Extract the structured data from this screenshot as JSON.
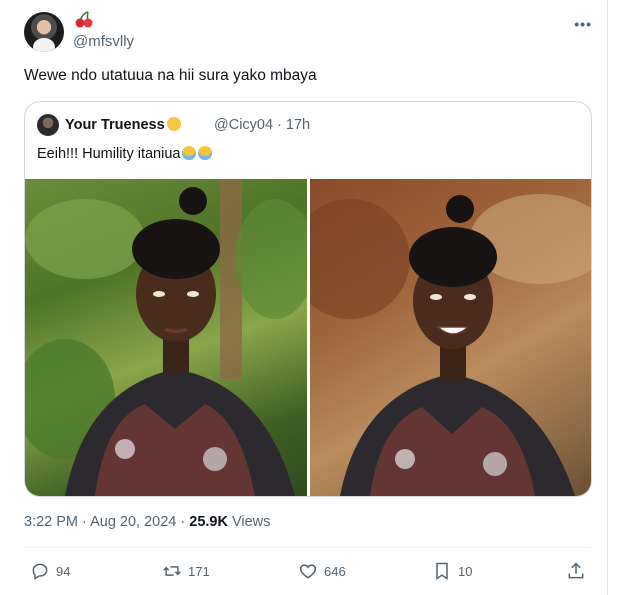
{
  "author": {
    "handle": "@mfsvlly",
    "avatar_icon": "profile-photo",
    "badge_icon": "cherry-emoji"
  },
  "tweet": {
    "text": "Wewe ndo utatuua na hii sura yako mbaya"
  },
  "quote": {
    "name": "Your Trueness",
    "name_emoji": "relieved-face-emoji",
    "handle_time": "@Cicy04 · 17h",
    "text": "Eeih!!!  Humility itaniua",
    "text_emoji": "loudly-crying-face-emoji ×2",
    "photos": [
      "photo-left",
      "photo-right"
    ]
  },
  "meta": {
    "time_date": "3:22 PM · Aug 20, 2024 · ",
    "views_count": "25.9K",
    "views_label": " Views"
  },
  "actions": {
    "replies": "94",
    "reposts": "171",
    "likes": "646",
    "bookmarks": "10"
  },
  "colors": {
    "text": "#0f1419",
    "secondary": "#536471",
    "border": "#cfd9de"
  }
}
